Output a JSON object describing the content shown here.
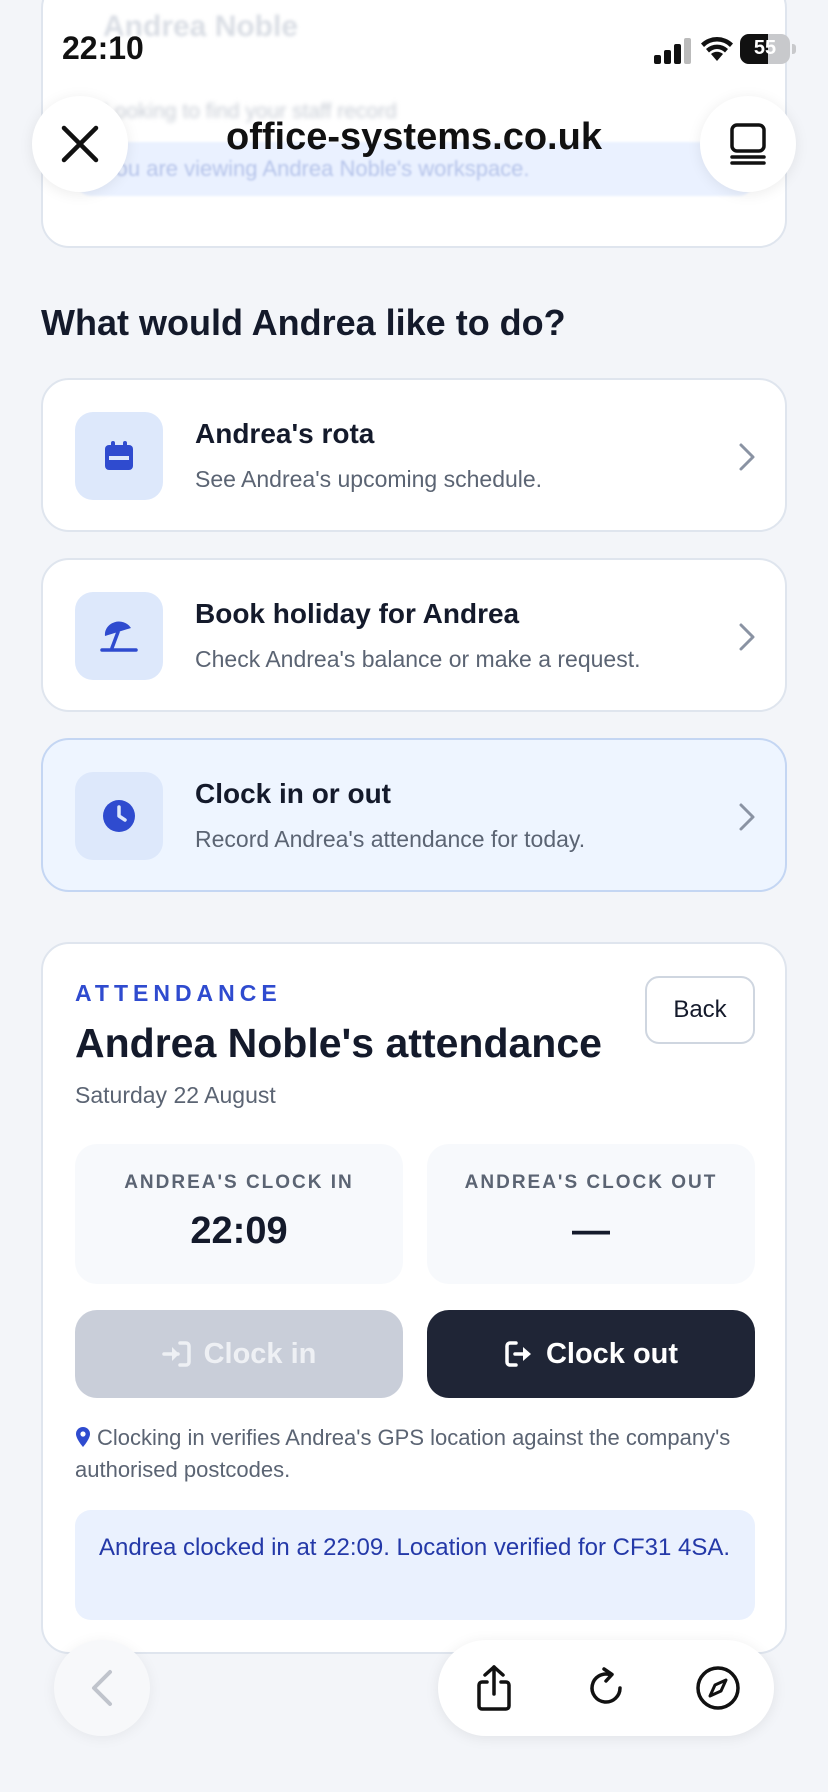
{
  "status_bar": {
    "time": "22:10",
    "battery_text": "55",
    "battery_level_percent": 55
  },
  "browser": {
    "url": "office-systems.co.uk",
    "close_icon": "close-icon",
    "tabs_icon": "tabs-icon"
  },
  "background_card": {
    "name": "Andrea Noble",
    "subtitle": "Looking to find your staff record",
    "banner": "You are viewing Andrea Noble's workspace."
  },
  "section_heading": "What would Andrea like to do?",
  "actions": [
    {
      "title": "Andrea's rota",
      "description": "See Andrea's upcoming schedule.",
      "icon": "calendar-icon"
    },
    {
      "title": "Book holiday for Andrea",
      "description": "Check Andrea's balance or make a request.",
      "icon": "beach-umbrella-icon"
    },
    {
      "title": "Clock in or out",
      "description": "Record Andrea's attendance for today.",
      "icon": "clock-icon"
    }
  ],
  "attendance": {
    "eyebrow": "ATTENDANCE",
    "title": "Andrea Noble's attendance",
    "date": "Saturday 22 August",
    "back_label": "Back",
    "clock_in_label": "ANDREA'S CLOCK IN",
    "clock_in_value": "22:09",
    "clock_out_label": "ANDREA'S CLOCK OUT",
    "clock_out_value": "—",
    "clock_in_button": "Clock in",
    "clock_out_button": "Clock out",
    "note": "Clocking in verifies Andrea's GPS location against the company's authorised postcodes.",
    "confirmation": "Andrea clocked in at 22:09. Location verified for CF31 4SA."
  },
  "colors": {
    "accent": "#2f4bcf",
    "icon_tint": "#dde8fb",
    "primary_button": "#1f2536",
    "disabled_button": "#c9ced9",
    "alert_bg": "#eaf1fe",
    "alert_text": "#2439a8"
  },
  "toolbar_icons": [
    "back-icon",
    "share-icon",
    "reload-icon",
    "compass-icon"
  ]
}
